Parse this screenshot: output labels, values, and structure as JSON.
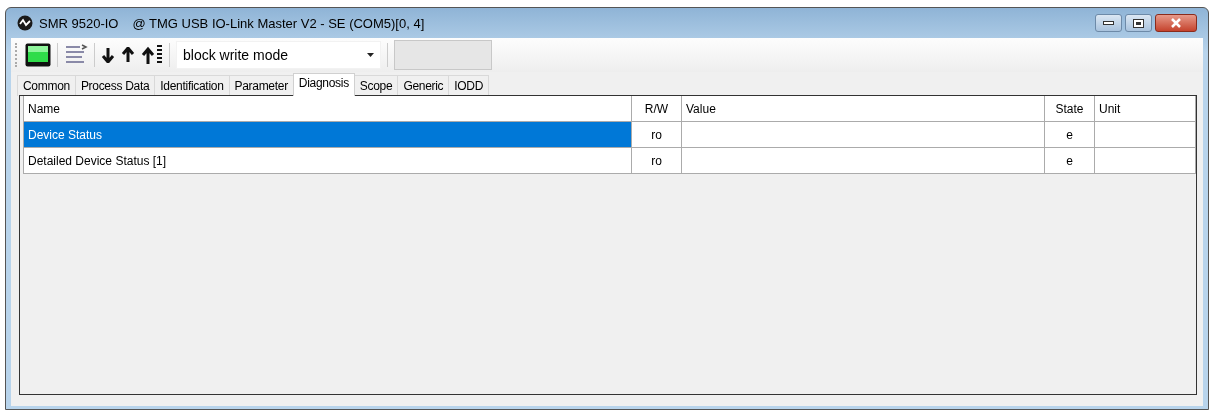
{
  "window": {
    "device": "SMR 9520-IO",
    "title": "@ TMG USB IO-Link Master V2 - SE  (COM5)[0, 4]"
  },
  "toolbar": {
    "mode": {
      "value": "block write mode"
    }
  },
  "tabs": [
    {
      "label": "Common",
      "selected": false
    },
    {
      "label": "Process Data",
      "selected": false
    },
    {
      "label": "Identification",
      "selected": false
    },
    {
      "label": "Parameter",
      "selected": false
    },
    {
      "label": "Diagnosis",
      "selected": true
    },
    {
      "label": "Scope",
      "selected": false
    },
    {
      "label": "Generic",
      "selected": false
    },
    {
      "label": "IODD",
      "selected": false
    }
  ],
  "table": {
    "columns": [
      {
        "label": "Name",
        "kind": "text"
      },
      {
        "label": "R/W",
        "kind": "flag"
      },
      {
        "label": "Value",
        "kind": "text"
      },
      {
        "label": "State",
        "kind": "flag"
      },
      {
        "label": "Unit",
        "kind": "text"
      }
    ],
    "rows": [
      {
        "cells": [
          "Device Status",
          "ro",
          "",
          "e",
          ""
        ],
        "selected": true
      },
      {
        "cells": [
          "Detailed Device Status [1]",
          "ro",
          "",
          "e",
          ""
        ],
        "selected": false
      }
    ]
  }
}
